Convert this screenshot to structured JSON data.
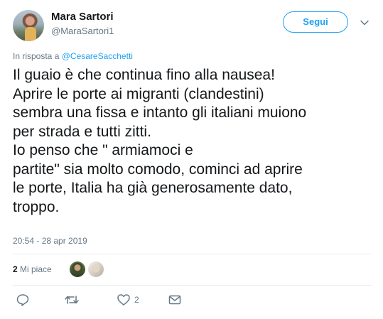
{
  "header": {
    "display_name": "Mara Sartori",
    "handle": "@MaraSartori1",
    "follow_label": "Segui"
  },
  "reply_context": {
    "prefix": "In risposta a",
    "mention": "@CesareSacchetti"
  },
  "tweet": {
    "lines": [
      "Il guaio è che continua fino alla nausea!",
      "Aprire le porte ai migranti (clandestini)",
      "sembra una fissa e intanto gli italiani muiono",
      "per strada e tutti zitti.",
      "Io penso che \" armiamoci e",
      "partite\" sia molto comodo, cominci ad aprire",
      "le porte, Italia ha già generosamente dato,",
      "troppo."
    ],
    "timestamp": "20:54 - 28 apr 2019"
  },
  "likes": {
    "count": "2",
    "label": "Mi piace"
  },
  "actions": {
    "reply_icon": "reply-icon",
    "retweet_icon": "retweet-icon",
    "like_icon": "heart-icon",
    "like_count": "2",
    "dm_icon": "envelope-icon"
  },
  "colors": {
    "accent": "#1da1f2",
    "secondary_text": "#657786",
    "divider": "#e6ecf0"
  }
}
